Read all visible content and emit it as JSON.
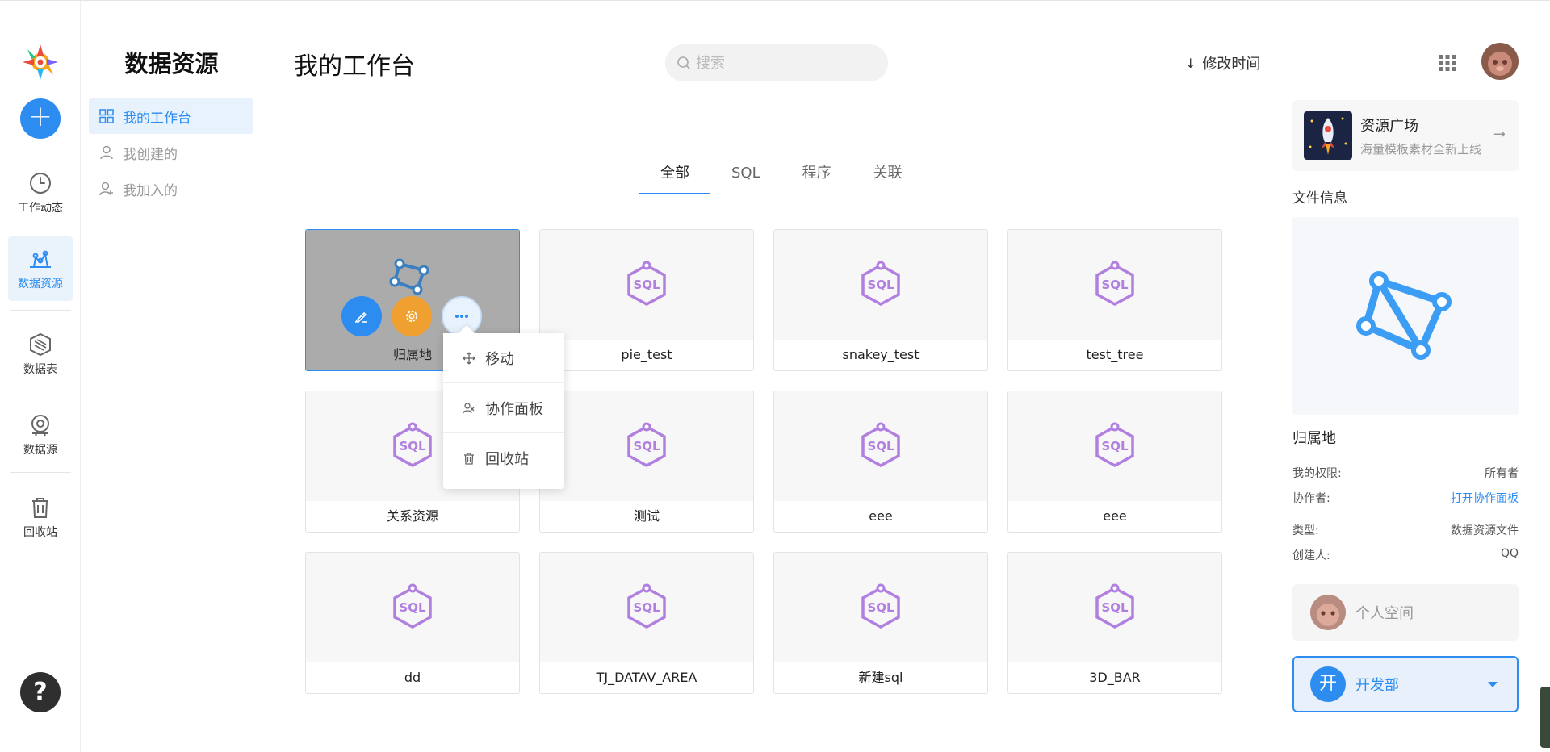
{
  "nav": {
    "items": [
      {
        "label": "工作动态",
        "icon": "clock-icon"
      },
      {
        "label": "数据资源",
        "icon": "data-resource-icon"
      },
      {
        "label": "数据表",
        "icon": "data-table-icon"
      },
      {
        "label": "数据源",
        "icon": "data-source-icon"
      },
      {
        "label": "回收站",
        "icon": "trash-icon"
      }
    ],
    "add_label": "+",
    "help_label": "?"
  },
  "sidebar": {
    "title": "数据资源",
    "items": [
      {
        "label": "我的工作台",
        "icon": "grid-icon"
      },
      {
        "label": "我创建的",
        "icon": "user-icon"
      },
      {
        "label": "我加入的",
        "icon": "user-add-icon"
      }
    ]
  },
  "header": {
    "title": "我的工作台",
    "search_placeholder": "搜索",
    "sort_label": "修改时间",
    "sort_arrow": "↓"
  },
  "tabs": [
    {
      "label": "全部"
    },
    {
      "label": "SQL"
    },
    {
      "label": "程序"
    },
    {
      "label": "关联"
    }
  ],
  "files": [
    {
      "name": "归属地",
      "type": "relation"
    },
    {
      "name": "pie_test",
      "type": "sql"
    },
    {
      "name": "snakey_test",
      "type": "sql"
    },
    {
      "name": "test_tree",
      "type": "sql"
    },
    {
      "name": "关系资源",
      "type": "sql"
    },
    {
      "name": "测试",
      "type": "sql"
    },
    {
      "name": "eee",
      "type": "sql"
    },
    {
      "name": "eee",
      "type": "sql"
    },
    {
      "name": "dd",
      "type": "sql"
    },
    {
      "name": "TJ_DATAV_AREA",
      "type": "sql"
    },
    {
      "name": "新建sql",
      "type": "sql"
    },
    {
      "name": "3D_BAR",
      "type": "sql"
    }
  ],
  "context_menu": {
    "items": [
      {
        "label": "移动",
        "icon": "move-icon"
      },
      {
        "label": "协作面板",
        "icon": "collab-icon"
      },
      {
        "label": "回收站",
        "icon": "trash-icon"
      }
    ]
  },
  "promo": {
    "title": "资源广场",
    "subtitle": "海量模板素材全新上线",
    "arrow": "→"
  },
  "file_info": {
    "title": "文件信息",
    "name": "归属地",
    "rows": [
      {
        "key": "我的权限:",
        "value": "所有者"
      },
      {
        "key": "协作者:",
        "value": "打开协作面板"
      },
      {
        "key": "类型:",
        "value": "数据资源文件"
      },
      {
        "key": "创建人:",
        "value": "QQ"
      }
    ]
  },
  "workspace": {
    "personal_label": "个人空间",
    "dept_badge": "开",
    "dept_label": "开发部"
  },
  "sql_badge_text": "SQL",
  "colors": {
    "primary": "#2d8cf0",
    "sql_purple": "#b07fe0",
    "edit_button": "#2d8cf0",
    "settings_button": "#f0a030"
  }
}
